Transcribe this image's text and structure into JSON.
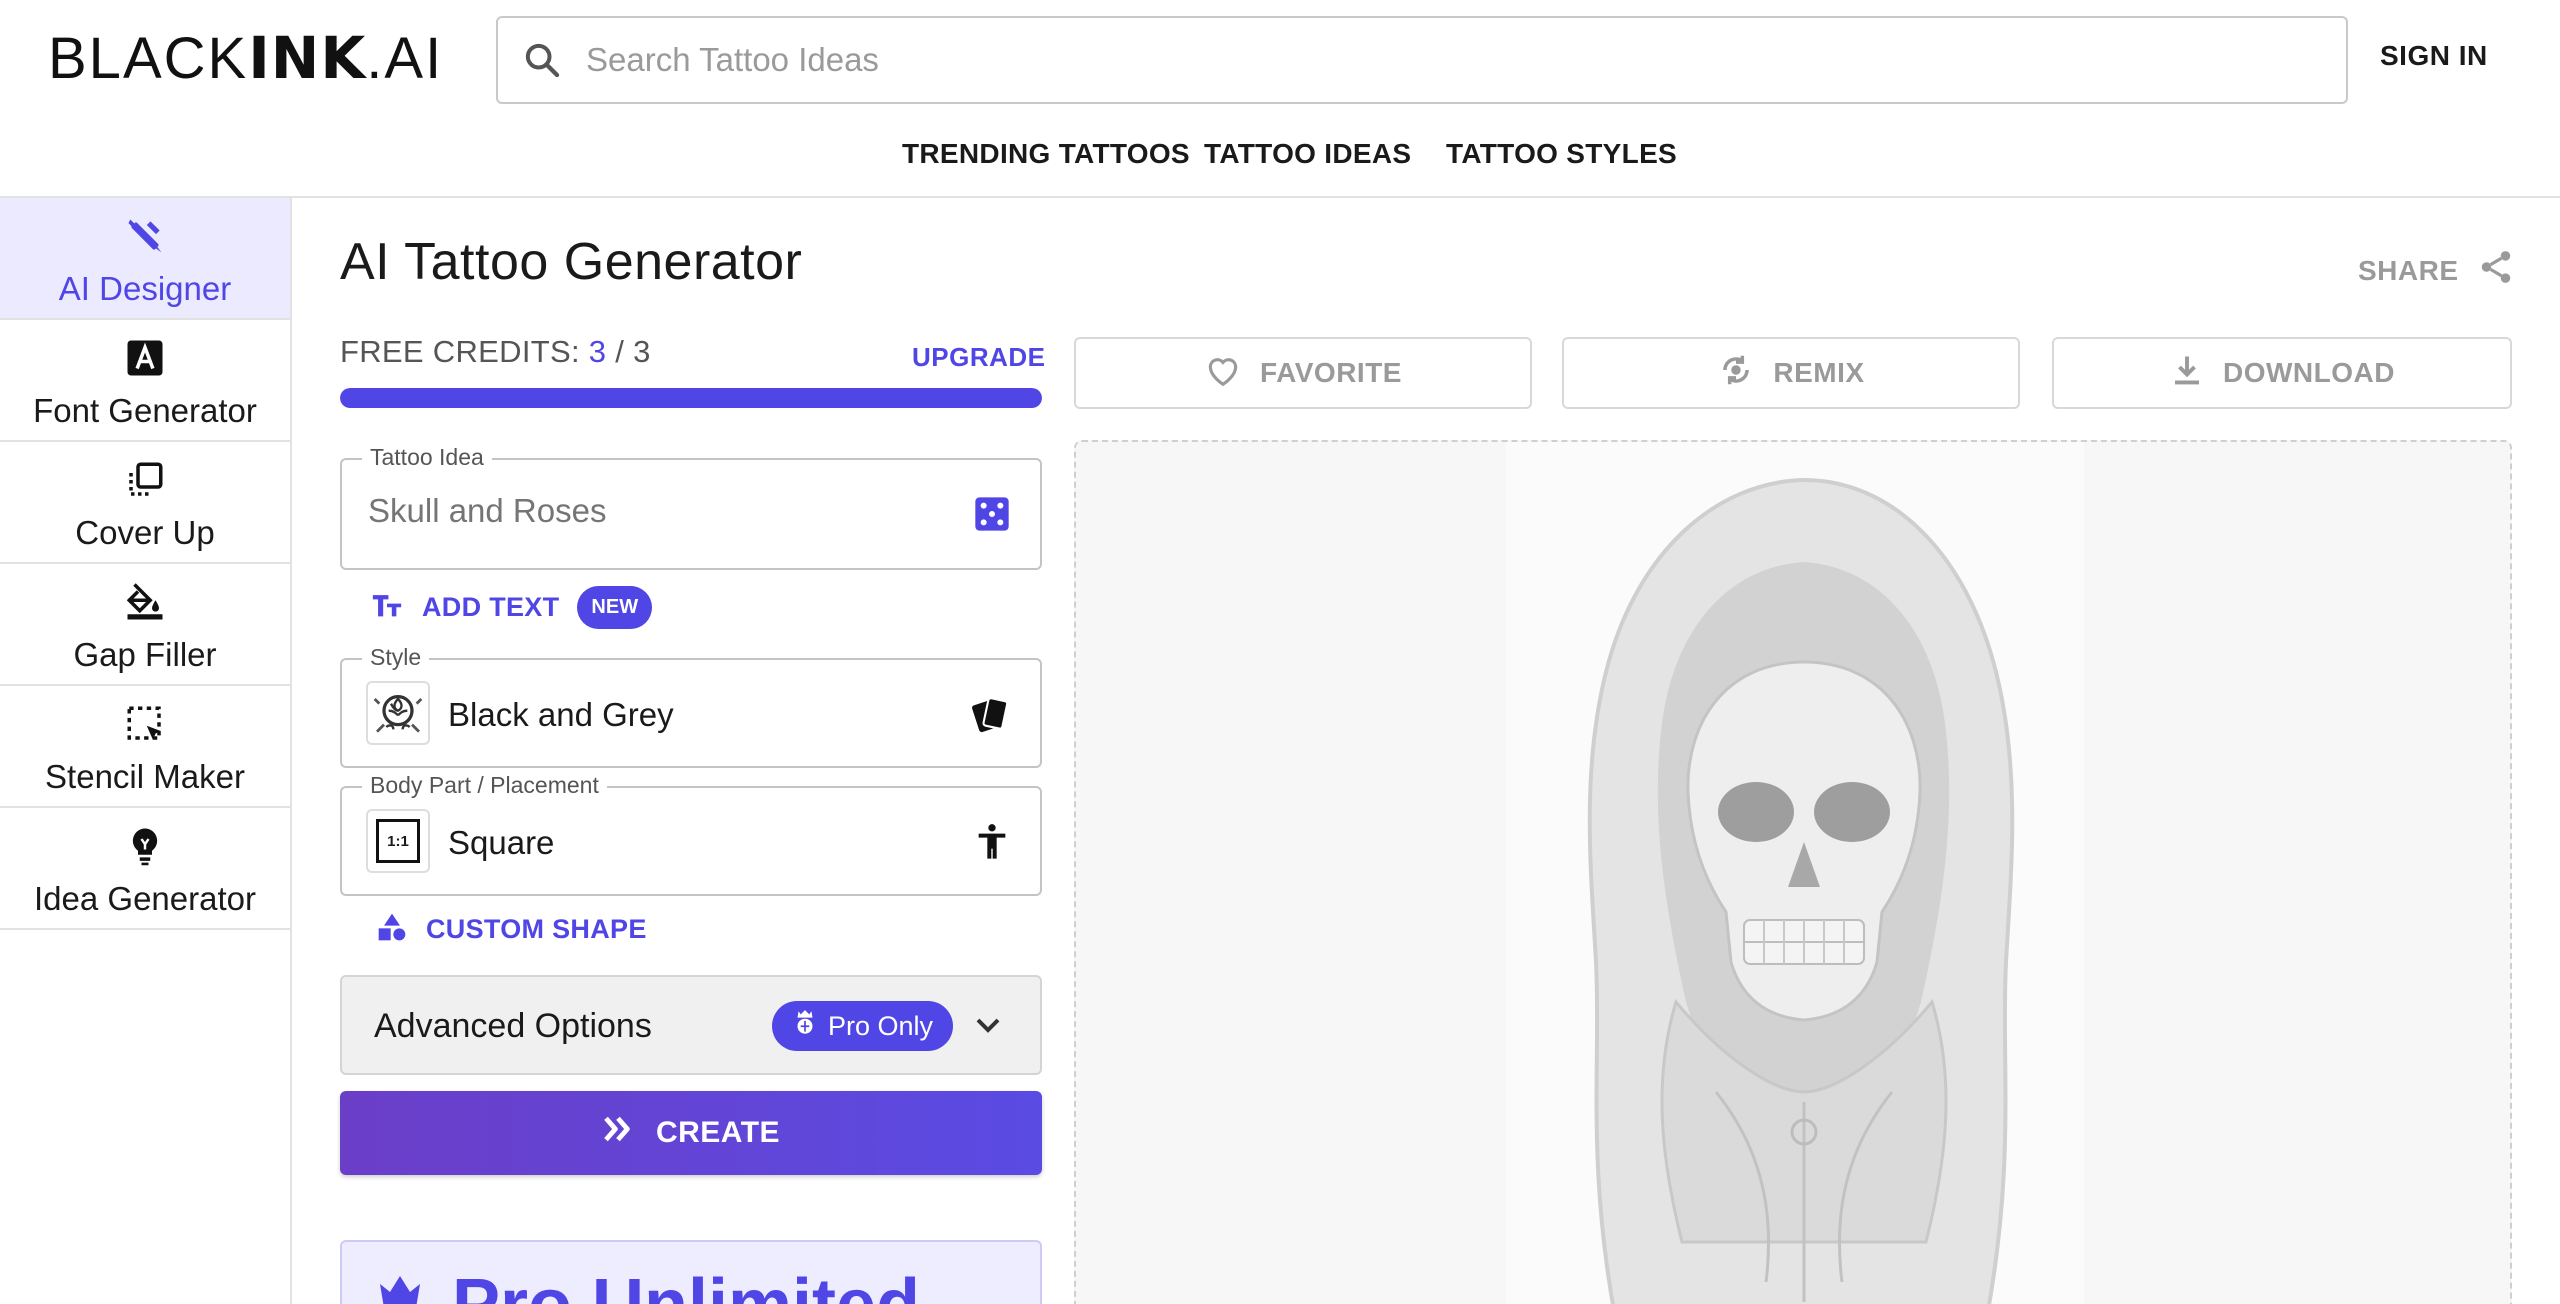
{
  "header": {
    "logo_thin": "BLACK",
    "logo_bold": "INK",
    "logo_tail": ".AI",
    "search_placeholder": "Search Tattoo Ideas",
    "sign_in": "SIGN IN",
    "nav": [
      "TRENDING TATTOOS",
      "TATTOO IDEAS",
      "TATTOO STYLES"
    ]
  },
  "sidebar": {
    "items": [
      {
        "label": "AI Designer",
        "icon": "pencil-ruler-icon",
        "active": true
      },
      {
        "label": "Font Generator",
        "icon": "font-a-icon",
        "active": false
      },
      {
        "label": "Cover Up",
        "icon": "layers-icon",
        "active": false
      },
      {
        "label": "Gap Filler",
        "icon": "paint-bucket-icon",
        "active": false
      },
      {
        "label": "Stencil Maker",
        "icon": "select-cursor-icon",
        "active": false
      },
      {
        "label": "Idea Generator",
        "icon": "lightbulb-icon",
        "active": false
      }
    ]
  },
  "main": {
    "title": "AI Tattoo Generator",
    "share": "SHARE",
    "credits": {
      "label": "FREE CREDITS: ",
      "used": "3",
      "sep": " / ",
      "total": "3",
      "fraction": 1.0
    },
    "upgrade": "UPGRADE",
    "tattoo_idea": {
      "legend": "Tattoo Idea",
      "placeholder": "Skull and Roses"
    },
    "add_text": {
      "label": "ADD TEXT",
      "badge": "NEW"
    },
    "style": {
      "legend": "Style",
      "value": "Black and Grey"
    },
    "placement": {
      "legend": "Body Part / Placement",
      "value": "Square",
      "thumb_text": "1:1"
    },
    "custom_shape": "CUSTOM SHAPE",
    "advanced": {
      "label": "Advanced Options",
      "badge": "Pro Only"
    },
    "create": "CREATE",
    "promo": "Pro Unlimited"
  },
  "actions": {
    "favorite": "FAVORITE",
    "remix": "REMIX",
    "download": "DOWNLOAD"
  },
  "colors": {
    "accent": "#4f46e5",
    "active_bg": "#eceaff",
    "muted": "#9a9a9a"
  }
}
